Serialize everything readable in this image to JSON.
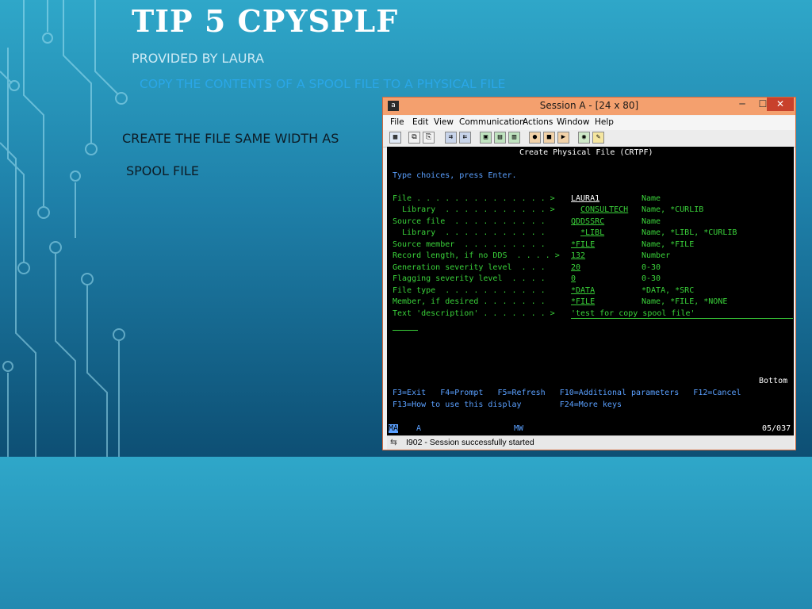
{
  "slide": {
    "title": "TIP 5 CPYSPLF",
    "subtitle": "PROVIDED BY LAURA",
    "description": "COPY THE CONTENTS OF A SPOOL FILE TO A PHYSICAL FILE",
    "bullets": [
      "CREATE THE FILE SAME WIDTH AS",
      "SPOOL FILE"
    ]
  },
  "window": {
    "icon": "terminal-icon",
    "title": "Session A - [24 x 80]",
    "controls": [
      "─",
      "☐",
      "✕"
    ],
    "menu": [
      "File",
      "Edit",
      "View",
      "Communication",
      "Actions",
      "Window",
      "Help"
    ]
  },
  "screen": {
    "heading": "Create Physical File (CRTPF)",
    "instructions": "Type choices, press Enter.",
    "fields": [
      {
        "label": "File . . . . . . . . . . . . . . >",
        "value": "LAURA1",
        "hint": "Name"
      },
      {
        "label": "  Library  . . . . . . . . . . . >",
        "value": "CONSULTECH",
        "hint": "Name, *CURLIB"
      },
      {
        "label": "Source file  . . . . . . . . . .",
        "value": "QDDSSRC",
        "hint": "Name"
      },
      {
        "label": "  Library  . . . . . . . . . . .",
        "value": "*LIBL",
        "hint": "Name, *LIBL, *CURLIB"
      },
      {
        "label": "Source member  . . . . . . . . .",
        "value": "*FILE",
        "hint": "Name, *FILE"
      },
      {
        "label": "Record length, if no DDS  . . . . >",
        "value": "132",
        "hint": "Number"
      },
      {
        "label": "Generation severity level  . . .",
        "value": "20",
        "hint": "0-30"
      },
      {
        "label": "Flagging severity level  . . . .",
        "value": "0",
        "hint": "0-30"
      },
      {
        "label": "File type  . . . . . . . . . . .",
        "value": "*DATA",
        "hint": "*DATA, *SRC"
      },
      {
        "label": "Member, if desired . . . . . . .",
        "value": "*FILE",
        "hint": "Name, *FILE, *NONE"
      },
      {
        "label": "Text 'description' . . . . . . . >",
        "value": "'test for copy spool file'",
        "hint": ""
      }
    ],
    "more": "Bottom",
    "fkeys_line1": "F3=Exit   F4=Prompt   F5=Refresh   F10=Additional parameters   F12=Cancel",
    "fkeys_line2": "F13=How to use this display        F24=More keys"
  },
  "status": {
    "mode": "MA",
    "session": "A",
    "indicator": "MW",
    "cursor": "05/037"
  },
  "message": "I902 - Session successfully started",
  "colors": {
    "field_green": "#3ad23a",
    "text_blue": "#5aa0ff",
    "input_white": "#ffffff",
    "titlebar": "#f4a06e"
  }
}
